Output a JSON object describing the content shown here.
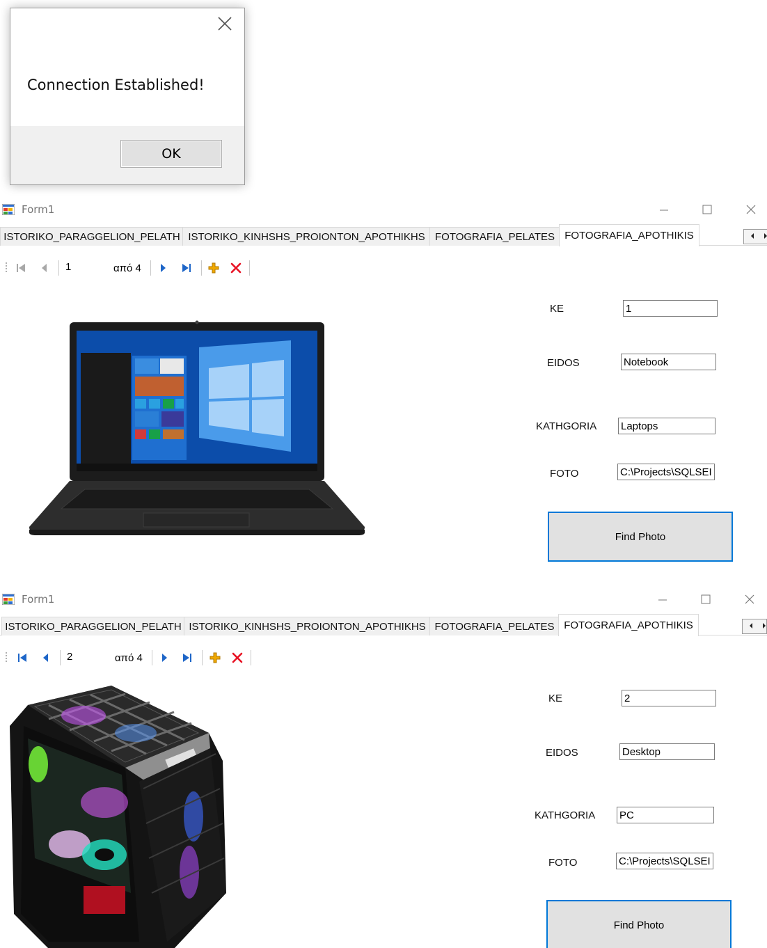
{
  "message_box": {
    "message": "Connection Established!",
    "ok_label": "OK"
  },
  "tabs_labels": [
    "ISTORIKO_PARAGGELION_PELATH",
    "ISTORIKO_KINHSHS_PROIONTON_APOTHIKHS",
    "FOTOGRAFIA_PELATES",
    "FOTOGRAFIA_APOTHIKIS"
  ],
  "selected_tab": "FOTOGRAFIA_APOTHIKIS",
  "forms": [
    {
      "window_title": "Form1",
      "navigator": {
        "position": "1",
        "count_label": "από 4"
      },
      "fields": {
        "ke_label": "KE",
        "ke_value": "1",
        "eidos_label": "EIDOS",
        "eidos_value": "Notebook",
        "kathgoria_label": "KATHGORIA",
        "kathgoria_value": "Laptops",
        "foto_label": "FOTO",
        "foto_value": "C:\\Projects\\SQLSEI"
      },
      "find_photo_label": "Find Photo",
      "photo": "laptop-photo"
    },
    {
      "window_title": "Form1",
      "navigator": {
        "position": "2",
        "count_label": "από 4"
      },
      "fields": {
        "ke_label": "KE",
        "ke_value": "2",
        "eidos_label": "EIDOS",
        "eidos_value": "Desktop",
        "kathgoria_label": "KATHGORIA",
        "kathgoria_value": "PC",
        "foto_label": "FOTO",
        "foto_value": "C:\\Projects\\SQLSEI"
      },
      "find_photo_label": "Find Photo",
      "photo": "desktop-pc-photo"
    }
  ],
  "colors": {
    "accent": "#0078d7",
    "delete": "#e81123",
    "add": "#f0a800",
    "nav_arrow": "#1e66c8"
  }
}
